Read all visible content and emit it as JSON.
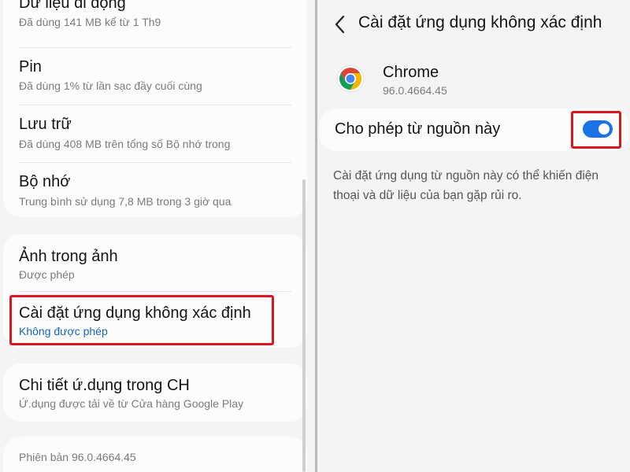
{
  "left_panel": {
    "items": [
      {
        "title": "Dữ liệu di động",
        "subtitle": "Đã dùng 141 MB kể từ 1 Th9"
      },
      {
        "title": "Pin",
        "subtitle": "Đã dùng 1% từ lần sạc đầy cuối cùng"
      },
      {
        "title": "Lưu trữ",
        "subtitle": "Đã dùng 408 MB trên tổng số Bộ nhớ trong"
      },
      {
        "title": "Bộ nhớ",
        "subtitle": "Trung bình sử dụng 7,8 MB trong 3 giờ qua"
      },
      {
        "title": "Ảnh trong ảnh",
        "subtitle": "Được phép"
      },
      {
        "title": "Cài đặt ứng dụng không xác định",
        "subtitle": "Không được phép"
      },
      {
        "title": "Chi tiết ứ.dụng trong CH",
        "subtitle": "Ứ.dụng được tải về từ Cửa hàng Google Play"
      }
    ],
    "version": "Phiên bản 96.0.4664.45"
  },
  "right_panel": {
    "header_title": "Cài đặt ứng dụng không xác định",
    "app_name": "Chrome",
    "app_version": "96.0.4664.45",
    "toggle_label": "Cho phép từ nguồn này",
    "toggle_on": true,
    "description": "Cài đặt ứng dụng từ nguồn này có thể khiến điện thoại và dữ liệu của bạn gặp rủi ro."
  },
  "colors": {
    "accent": "#1a73e8",
    "link_blue": "#1467b8",
    "highlight_red": "#d8171f",
    "background": "#f4f4f4"
  },
  "icons": [
    "back-arrow-icon",
    "chrome-icon"
  ]
}
